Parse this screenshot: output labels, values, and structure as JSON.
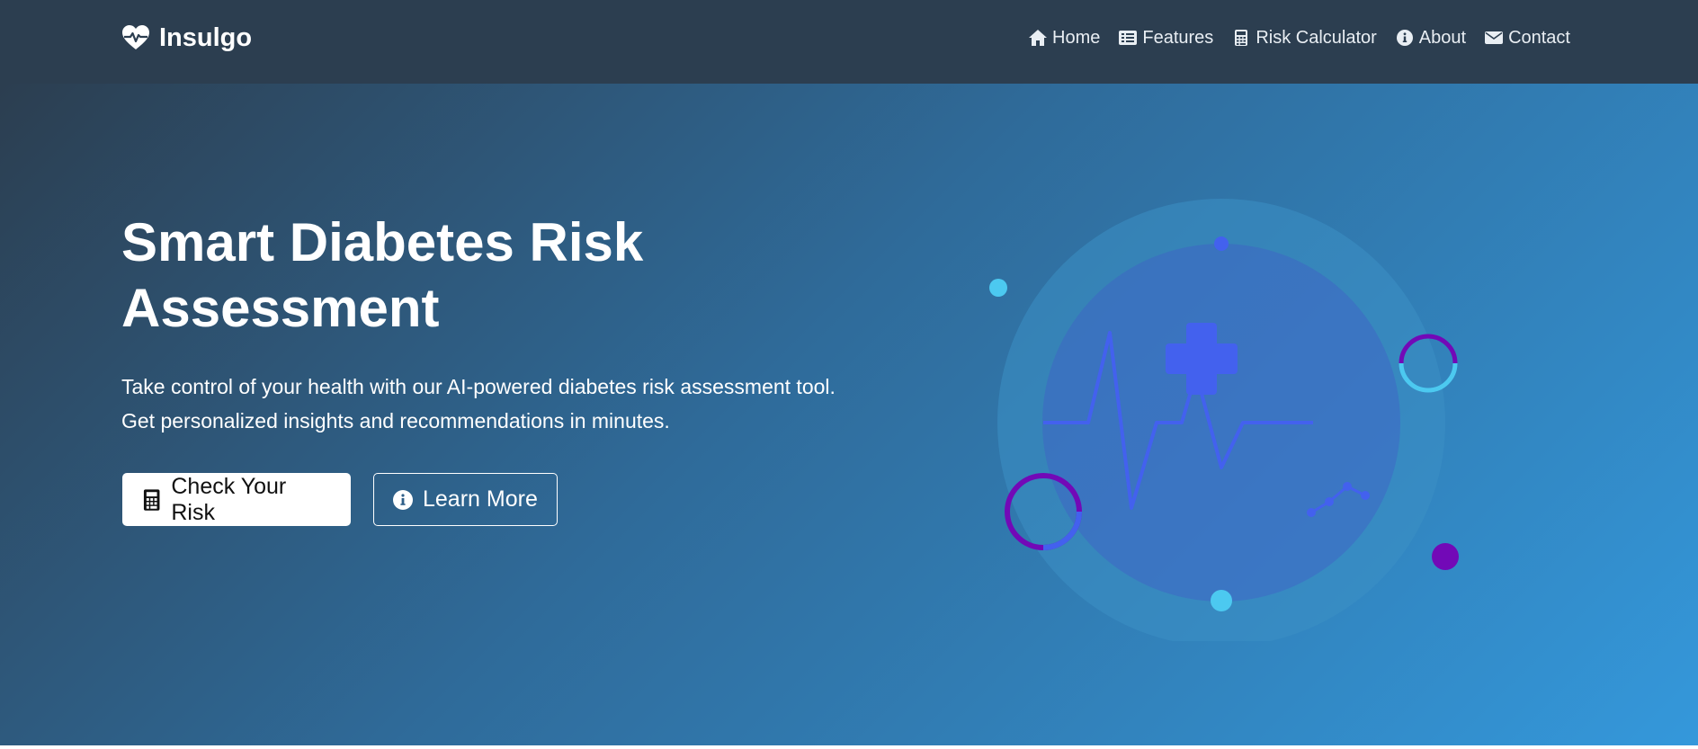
{
  "navbar": {
    "brand": "Insulgo",
    "links": [
      {
        "label": "Home",
        "icon": "home-icon"
      },
      {
        "label": "Features",
        "icon": "list-icon"
      },
      {
        "label": "Risk Calculator",
        "icon": "calculator-icon"
      },
      {
        "label": "About",
        "icon": "info-circle-icon"
      },
      {
        "label": "Contact",
        "icon": "envelope-icon"
      }
    ]
  },
  "hero": {
    "title": "Smart Diabetes Risk Assessment",
    "subtitle": "Take control of your health with our AI-powered diabetes risk assessment tool. Get personalized insights and recommendations in minutes.",
    "primary_button": "Check Your Risk",
    "secondary_button": "Learn More"
  },
  "colors": {
    "navbar_bg": "#2c3e50",
    "hero_gradient_start": "#2c3e50",
    "hero_gradient_end": "#3498db",
    "accent_blue": "#4361ee",
    "accent_cyan": "#4cc9f0",
    "accent_purple": "#7209b7"
  }
}
